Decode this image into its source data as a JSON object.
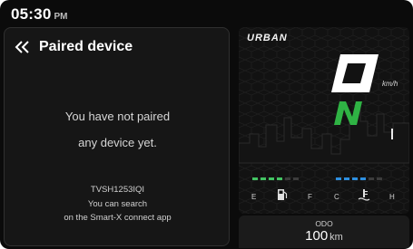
{
  "status_bar": {
    "time": "05:30",
    "ampm": "PM"
  },
  "pairing": {
    "title": "Paired device",
    "back_icon": "double-chevron-left-icon",
    "message_line1": "You have not paired",
    "message_line2": "any device yet.",
    "device_id": "TVSH1253IQI",
    "hint_line1": "You can search",
    "hint_line2": "on the Smart-X connect app"
  },
  "cluster": {
    "ride_mode": "URBAN",
    "speed": "0",
    "speed_unit": "km/h",
    "gear": "N",
    "fuel": {
      "empty_label": "E",
      "full_label": "F",
      "icon": "fuel-pump-icon",
      "level_segments": 4,
      "total_segments": 6
    },
    "temperature": {
      "cold_label": "C",
      "hot_label": "H",
      "icon": "coolant-temperature-icon",
      "level_segments": 4,
      "total_segments": 6
    },
    "odo": {
      "label": "ODO",
      "value": "100",
      "unit": "km"
    },
    "colors": {
      "gear": "#2fb344",
      "fuel_fill": "#43c463",
      "temp_fill": "#2d8fe0",
      "segment_empty": "#3c3c3c"
    }
  }
}
